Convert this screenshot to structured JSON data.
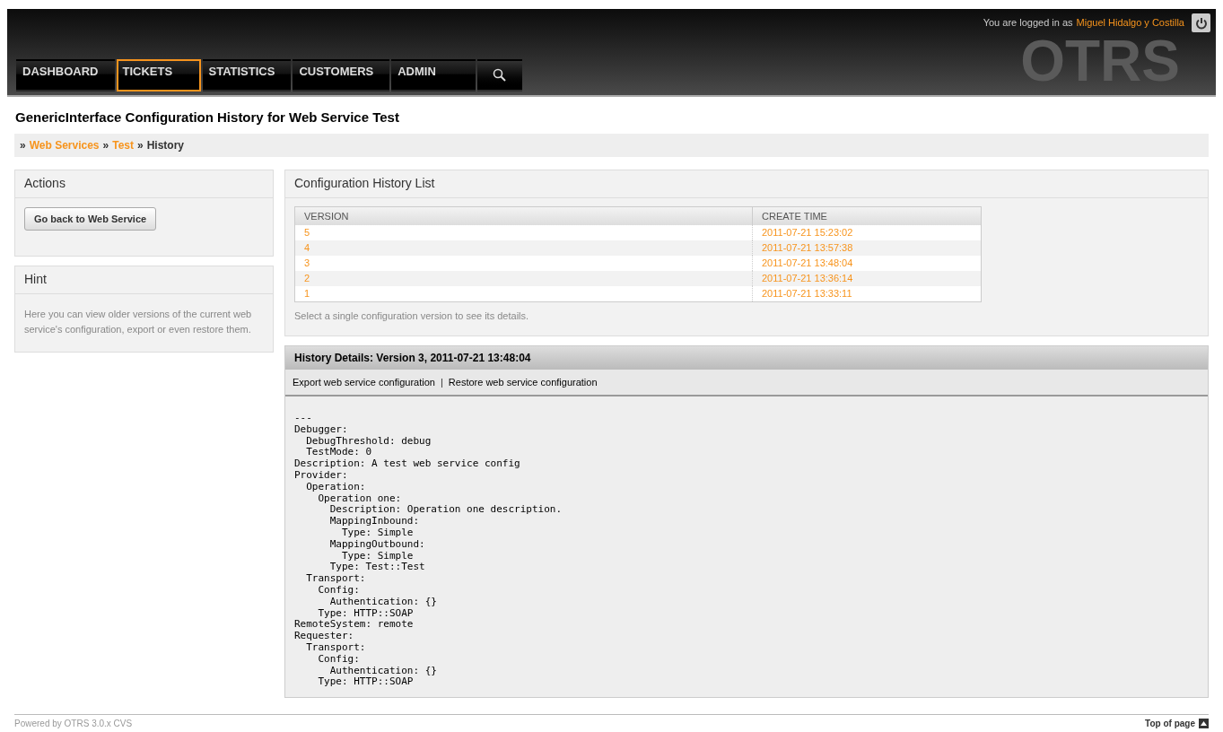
{
  "header": {
    "logo": "OTRS",
    "login_prefix": "You are logged in as",
    "user_name": "Miguel Hidalgo y Costilla",
    "nav": [
      {
        "label": "DASHBOARD",
        "selected": false,
        "kind": "text"
      },
      {
        "label": "TICKETS",
        "selected": true,
        "kind": "text"
      },
      {
        "label": "STATISTICS",
        "selected": false,
        "kind": "text"
      },
      {
        "label": "CUSTOMERS",
        "selected": false,
        "kind": "text"
      },
      {
        "label": "ADMIN",
        "selected": false,
        "kind": "text"
      },
      {
        "selected": false,
        "kind": "search"
      }
    ]
  },
  "page_title": "GenericInterface Configuration History for Web Service Test",
  "breadcrumb_separator": "»",
  "breadcrumb": [
    {
      "label": "Web Services",
      "kind": "link"
    },
    {
      "label": "Test",
      "kind": "link"
    },
    {
      "label": "History",
      "kind": "current"
    }
  ],
  "sidebar": {
    "actions": {
      "title": "Actions",
      "button": "Go back to Web Service"
    },
    "hint": {
      "title": "Hint",
      "text": "Here you can view older versions of the current web service's configuration, export or even restore them."
    }
  },
  "history_list": {
    "title": "Configuration History List",
    "columns": [
      "VERSION",
      "CREATE TIME"
    ],
    "rows": [
      {
        "version": "5",
        "create_time": "2011-07-21 15:23:02"
      },
      {
        "version": "4",
        "create_time": "2011-07-21 13:57:38"
      },
      {
        "version": "3",
        "create_time": "2011-07-21 13:48:04"
      },
      {
        "version": "2",
        "create_time": "2011-07-21 13:36:14"
      },
      {
        "version": "1",
        "create_time": "2011-07-21 13:33:11"
      }
    ],
    "note": "Select a single configuration version to see its details."
  },
  "details": {
    "title": "History Details: Version 3, 2011-07-21 13:48:04",
    "actions": [
      "Export web service configuration",
      "Restore web service configuration"
    ],
    "separator": "|",
    "config": "---\nDebugger:\n  DebugThreshold: debug\n  TestMode: 0\nDescription: A test web service config\nProvider:\n  Operation:\n    Operation one:\n      Description: Operation one description.\n      MappingInbound:\n        Type: Simple\n      MappingOutbound:\n        Type: Simple\n      Type: Test::Test\n  Transport:\n    Config:\n      Authentication: {}\n    Type: HTTP::SOAP\nRemoteSystem: remote\nRequester:\n  Transport:\n    Config:\n      Authentication: {}\n    Type: HTTP::SOAP"
  },
  "footer": {
    "powered": "Powered by OTRS 3.0.x CVS",
    "top": "Top of page"
  }
}
